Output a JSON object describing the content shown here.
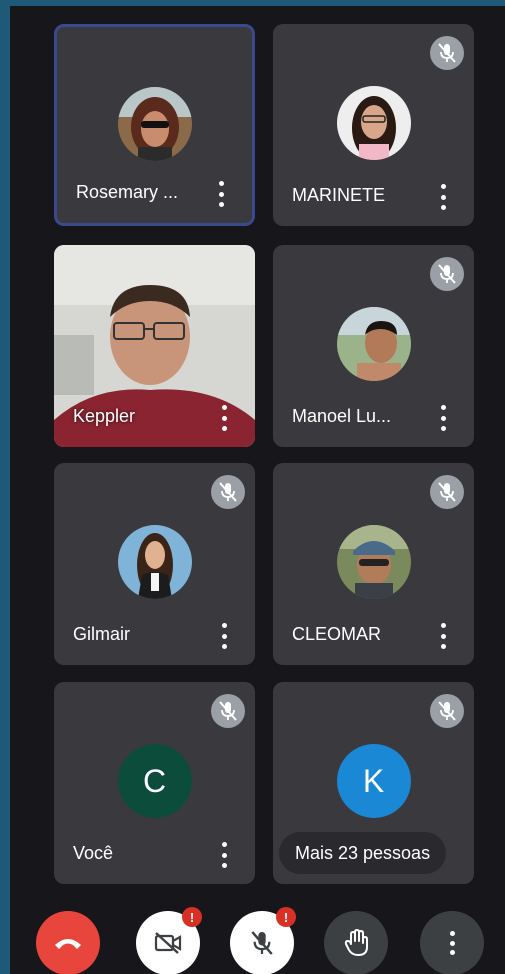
{
  "participants": [
    {
      "name": "Rosemary ...",
      "muted": false,
      "active": true
    },
    {
      "name": "MARINETE",
      "muted": true
    },
    {
      "name": "Keppler",
      "muted": false,
      "video": true
    },
    {
      "name": "Manoel Lu...",
      "muted": true
    },
    {
      "name": "Gilmair",
      "muted": true
    },
    {
      "name": "CLEOMAR",
      "muted": true
    },
    {
      "name": "Você",
      "muted": true,
      "initial": "C",
      "avatar_color": "#0b4d3a"
    },
    {
      "initial": "K",
      "muted": true,
      "avatar_color": "#1a88d4"
    }
  ],
  "more_people": "Mais 23 pessoas",
  "controls": {
    "end_call_color": "#e8453c",
    "camera_alert": "!",
    "mic_alert": "!"
  },
  "icons": [
    "mic-off-icon",
    "more-vert-icon",
    "hang-up-icon",
    "camera-off-icon",
    "hand-raise-icon"
  ]
}
